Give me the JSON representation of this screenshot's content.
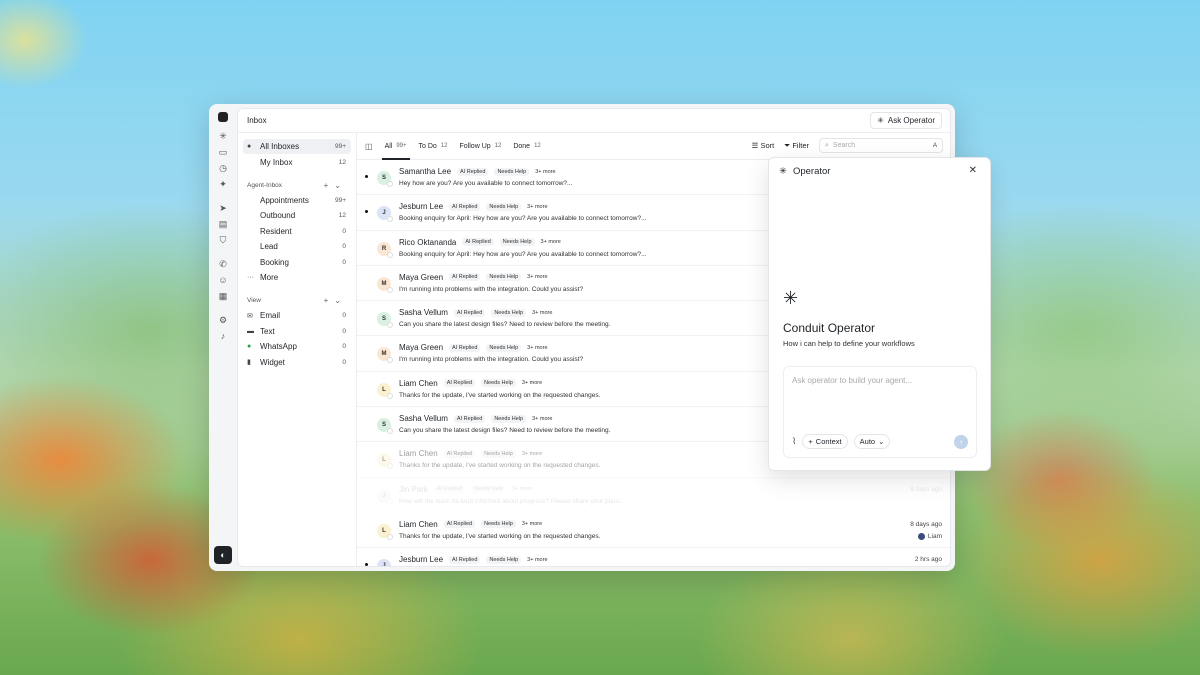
{
  "window": {
    "title": "Inbox",
    "ask_operator": "Ask Operator"
  },
  "sidebar": {
    "main_items": [
      {
        "label": "All Inboxes",
        "count": "99+"
      },
      {
        "label": "My Inbox",
        "count": "12"
      }
    ],
    "agent_section": "Agent-Inbox",
    "agent_items": [
      {
        "label": "Appointments",
        "count": "99+"
      },
      {
        "label": "Outbound",
        "count": "12"
      },
      {
        "label": "Resident",
        "count": "0"
      },
      {
        "label": "Lead",
        "count": "0"
      },
      {
        "label": "Booking",
        "count": "0"
      },
      {
        "label": "More",
        "count": ""
      }
    ],
    "view_section": "View",
    "view_items": [
      {
        "label": "Email",
        "count": "0"
      },
      {
        "label": "Text",
        "count": "0"
      },
      {
        "label": "WhatsApp",
        "count": "0"
      },
      {
        "label": "Widget",
        "count": "0"
      }
    ]
  },
  "tabs": [
    {
      "label": "All",
      "count": "99+"
    },
    {
      "label": "To Do",
      "count": "12"
    },
    {
      "label": "Follow Up",
      "count": "12"
    },
    {
      "label": "Done",
      "count": "12"
    }
  ],
  "tools": {
    "sort": "Sort",
    "filter": "Filter",
    "search_placeholder": "Search",
    "search_kbd": "A"
  },
  "tags": {
    "ai": "AI Replied",
    "help": "Needs Help",
    "more": "3+ more"
  },
  "conversations": [
    {
      "initial": "S",
      "name": "Samantha Lee",
      "message": "Hey how are you? Are you available to connect tomorrow?...",
      "unread": true,
      "time": "",
      "assignee": "",
      "avatar_color": "#d8f1e3"
    },
    {
      "initial": "J",
      "name": "Jesburn Lee",
      "message": "Booking enquiry for April: Hey how are you? Are you available to connect tomorrow?...",
      "unread": true,
      "time": "",
      "assignee": "",
      "avatar_color": "#dde4f7"
    },
    {
      "initial": "R",
      "name": "Rico Oktananda",
      "message": "Booking enquiry for April: Hey how are you? Are you available to connect tomorrow?...",
      "unread": false,
      "time": "",
      "assignee": "",
      "avatar_color": "#fbe6d4"
    },
    {
      "initial": "M",
      "name": "Maya Green",
      "message": "I'm running into problems with the integration. Could you assist?",
      "unread": false,
      "time": "",
      "assignee": "",
      "avatar_color": "#fbe6d4"
    },
    {
      "initial": "S",
      "name": "Sasha Vellum",
      "message": "Can you share the latest design files? Need to review before the meeting.",
      "unread": false,
      "time": "",
      "assignee": "",
      "avatar_color": "#d8f1e3"
    },
    {
      "initial": "M",
      "name": "Maya Green",
      "message": "I'm running into problems with the integration. Could you assist?",
      "unread": false,
      "time": "",
      "assignee": "",
      "avatar_color": "#fbe6d4"
    },
    {
      "initial": "L",
      "name": "Liam Chen",
      "message": "Thanks for the update, I've started working on the requested changes.",
      "unread": false,
      "time": "",
      "assignee": "",
      "avatar_color": "#fbf0d0"
    },
    {
      "initial": "S",
      "name": "Sasha Vellum",
      "message": "Can you share the latest design files? Need to review before the meeting.",
      "unread": false,
      "time": "",
      "assignee": "",
      "avatar_color": "#d8f1e3"
    },
    {
      "initial": "L",
      "name": "Liam Chen",
      "message": "Thanks for the update, I've started working on the requested changes.",
      "unread": false,
      "time": "",
      "assignee": "",
      "avatar_color": "#fbf0d0"
    },
    {
      "initial": "J",
      "name": "Jin Park",
      "message": "How will the team be kept informed about progress? Please share your plans.",
      "unread": false,
      "time": "8 days ago",
      "assignee": "",
      "avatar_color": "#dde4f7"
    },
    {
      "initial": "L",
      "name": "Liam Chen",
      "message": "Thanks for the update, I've started working on the requested changes.",
      "unread": false,
      "time": "8 days ago",
      "assignee": "Liam",
      "avatar_color": "#fbf0d0"
    },
    {
      "initial": "J",
      "name": "Jesburn Lee",
      "message": "",
      "unread": true,
      "time": "2 hrs ago",
      "assignee": "",
      "avatar_color": "#dde4f7"
    }
  ],
  "operator": {
    "header": "Operator",
    "title": "Conduit Operator",
    "subtitle": "How i can help to define your workflows",
    "input_placeholder": "Ask operator to build your agent...",
    "context_label": "Context",
    "mode_label": "Auto"
  }
}
